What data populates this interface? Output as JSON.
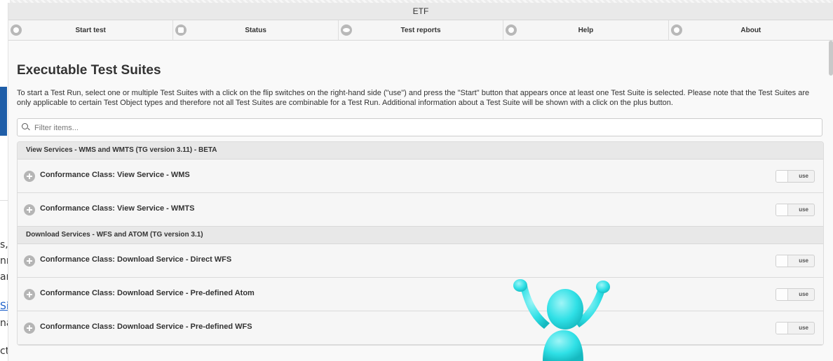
{
  "app": {
    "title": "ETF"
  },
  "nav": {
    "items": [
      {
        "label": "Start test",
        "icon": "start-test-icon"
      },
      {
        "label": "Status",
        "icon": "status-icon"
      },
      {
        "label": "Test reports",
        "icon": "eye-icon"
      },
      {
        "label": "Help",
        "icon": "help-icon"
      },
      {
        "label": "About",
        "icon": "about-icon"
      }
    ]
  },
  "page": {
    "title": "Executable Test Suites",
    "intro": "To start a Test Run, select one or multiple Test Suites with a click on the flip switches on the right-hand side (\"use\") and press the \"Start\" button that appears once at least one Test Suite is selected. Please note that the Test Suites are only applicable to certain Test Object types and therefore not all Test Suites are combinable for a Test Run. Additional information about a Test Suite will be shown with a click on the plus button."
  },
  "filter": {
    "placeholder": "Filter items..."
  },
  "groups": [
    {
      "header": "View Services - WMS and WMTS (TG version 3.11) - BETA",
      "suites": [
        {
          "name": "Conformance Class: View Service - WMS",
          "switch_label": "use"
        },
        {
          "name": "Conformance Class: View Service - WMTS",
          "switch_label": "use"
        }
      ]
    },
    {
      "header": "Download Services - WFS and ATOM (TG version 3.1)",
      "suites": [
        {
          "name": "Conformance Class: Download Service - Direct WFS",
          "switch_label": "use"
        },
        {
          "name": "Conformance Class: Download Service - Pre-defined Atom",
          "switch_label": "use"
        },
        {
          "name": "Conformance Class: Download Service - Pre-defined WFS",
          "switch_label": "use"
        }
      ]
    }
  ],
  "background_fragments": [
    "s,",
    "nr",
    "ar",
    "Si",
    "na",
    "ct"
  ],
  "colors": {
    "figure": "#2fe0e6",
    "accent_link": "#1a5ec9"
  }
}
